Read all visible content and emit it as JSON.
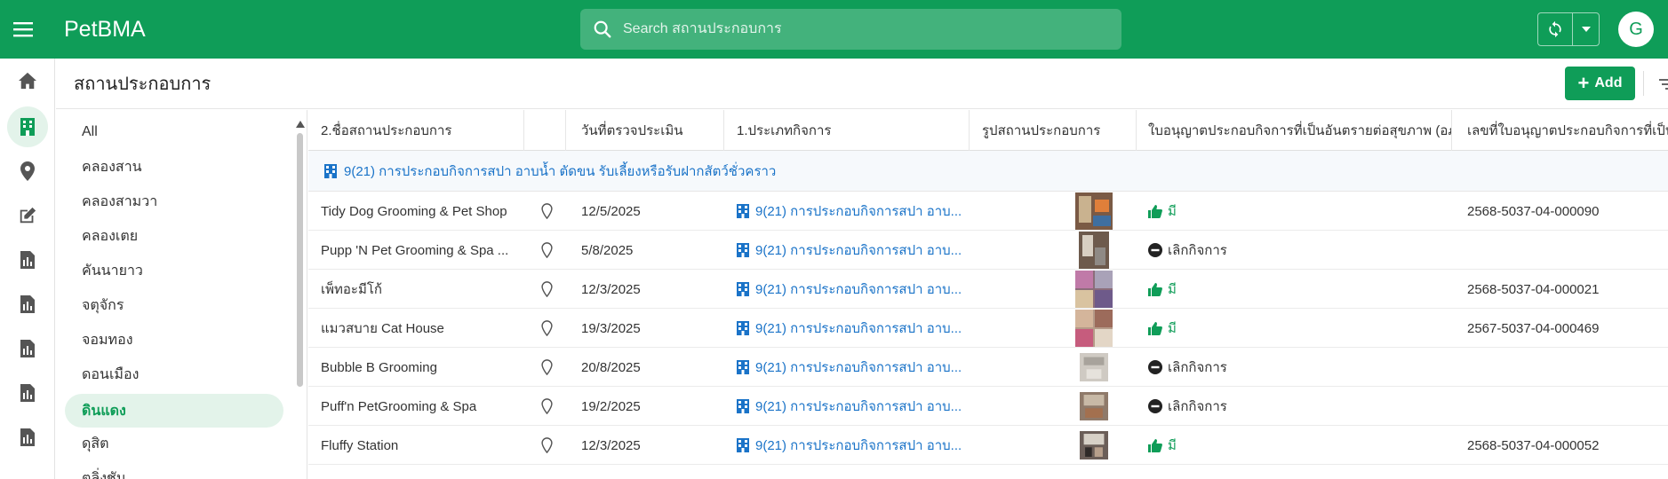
{
  "app": {
    "title": "PetBMA",
    "avatar_letter": "G"
  },
  "search": {
    "placeholder": "Search สถานประกอบการ"
  },
  "rail": {
    "items": [
      {
        "icon": "home-icon"
      },
      {
        "icon": "building-icon",
        "active": true
      },
      {
        "icon": "map-pin-icon"
      },
      {
        "icon": "edit-icon"
      },
      {
        "icon": "report-icon"
      },
      {
        "icon": "report-icon"
      },
      {
        "icon": "report-icon"
      },
      {
        "icon": "report-icon"
      },
      {
        "icon": "report-icon"
      }
    ]
  },
  "page": {
    "title": "สถานประกอบการ",
    "add_label": "Add"
  },
  "filters": {
    "items": [
      "All",
      "คลองสาน",
      "คลองสามวา",
      "คลองเตย",
      "คันนายาว",
      "จตุจักร",
      "จอมทอง",
      "ดอนเมือง",
      "ดินแดง",
      "ดุสิต",
      "ตลิ่งชัน"
    ],
    "active": "ดินแดง"
  },
  "table": {
    "columns": [
      "2.ชื่อสถานประกอบการ",
      "วันที่ตรวจประเมิน",
      "1.ประเภทกิจการ",
      "รูปสถานประกอบการ",
      "ใบอนุญาตประกอบกิจการที่เป็นอันตรายต่อสุขภาพ (อภ...",
      "เลขที่ใบอนุญาตประกอบกิจการที่เป็น"
    ],
    "group_label": "9(21) การประกอบกิจการสปา อาบน้ำ ตัดขน รับเลี้ยงหรือรับฝากสัตว์ชั่วคราว",
    "rows": [
      {
        "name": "Tidy Dog Grooming & Pet Shop",
        "date": "12/5/2025",
        "type": "9(21) การประกอบกิจการสปา อาบ...",
        "status": "มี",
        "status_kind": "yes",
        "license": "2568-5037-04-000090"
      },
      {
        "name": "Pupp 'N Pet Grooming & Spa ...",
        "date": "5/8/2025",
        "type": "9(21) การประกอบกิจการสปา อาบ...",
        "status": "เลิกกิจการ",
        "status_kind": "closed",
        "license": ""
      },
      {
        "name": "เพ็ทอะมีโก้",
        "date": "12/3/2025",
        "type": "9(21) การประกอบกิจการสปา อาบ...",
        "status": "มี",
        "status_kind": "yes",
        "license": "2568-5037-04-000021"
      },
      {
        "name": "แมวสบาย Cat House",
        "date": "19/3/2025",
        "type": "9(21) การประกอบกิจการสปา อาบ...",
        "status": "มี",
        "status_kind": "yes",
        "license": "2567-5037-04-000469"
      },
      {
        "name": "Bubble B Grooming",
        "date": "20/8/2025",
        "type": "9(21) การประกอบกิจการสปา อาบ...",
        "status": "เลิกกิจการ",
        "status_kind": "closed",
        "license": ""
      },
      {
        "name": "Puff'n PetGrooming & Spa",
        "date": "19/2/2025",
        "type": "9(21) การประกอบกิจการสปา อาบ...",
        "status": "เลิกกิจการ",
        "status_kind": "closed",
        "license": ""
      },
      {
        "name": "Fluffy Station",
        "date": "12/3/2025",
        "type": "9(21) การประกอบกิจการสปา อาบ...",
        "status": "มี",
        "status_kind": "yes",
        "license": "2568-5037-04-000052"
      }
    ]
  },
  "colors": {
    "brand": "#0f9d58",
    "link": "#1a73c8",
    "active_bg": "#e3f3ea"
  }
}
